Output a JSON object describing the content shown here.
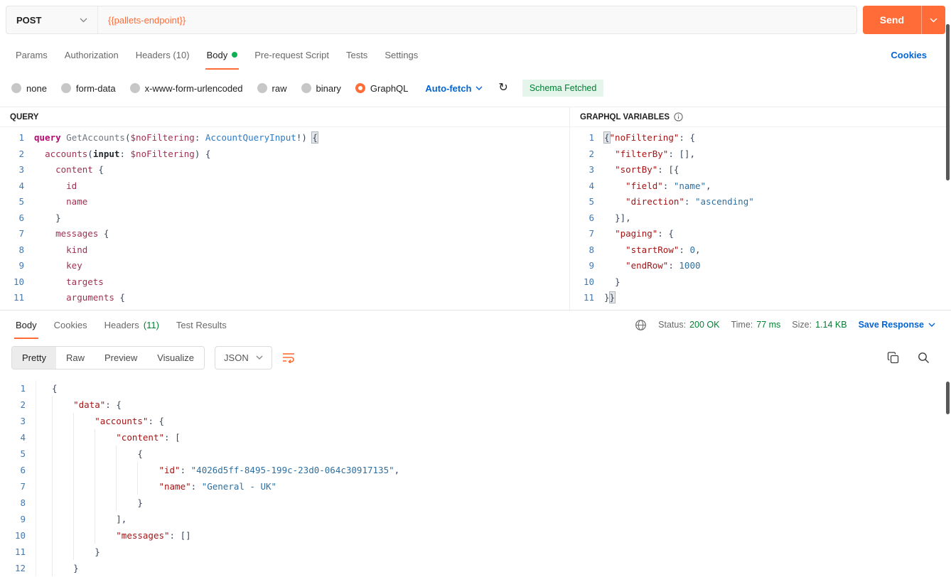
{
  "request": {
    "method": "POST",
    "url": "{{pallets-endpoint}}",
    "send_label": "Send"
  },
  "request_tabs": {
    "items": [
      {
        "label": "Params"
      },
      {
        "label": "Authorization"
      },
      {
        "label": "Headers (10)"
      },
      {
        "label": "Body"
      },
      {
        "label": "Pre-request Script"
      },
      {
        "label": "Tests"
      },
      {
        "label": "Settings"
      }
    ],
    "active": "Body",
    "cookies_link": "Cookies"
  },
  "body_type_bar": {
    "options": [
      {
        "label": "none",
        "selected": false
      },
      {
        "label": "form-data",
        "selected": false
      },
      {
        "label": "x-www-form-urlencoded",
        "selected": false
      },
      {
        "label": "raw",
        "selected": false
      },
      {
        "label": "binary",
        "selected": false
      },
      {
        "label": "GraphQL",
        "selected": true
      }
    ],
    "auto_fetch_label": "Auto-fetch",
    "schema_status": "Schema Fetched"
  },
  "query_panel": {
    "title": "QUERY",
    "code_lines": [
      [
        [
          "kw",
          "query"
        ],
        [
          "pl",
          " "
        ],
        [
          "def",
          "GetAccounts"
        ],
        [
          "pu",
          "("
        ],
        [
          "var",
          "$noFiltering"
        ],
        [
          "pu",
          ":"
        ],
        [
          "pl",
          " "
        ],
        [
          "type",
          "AccountQueryInput"
        ],
        [
          "pu",
          "!)"
        ],
        [
          "pl",
          " "
        ],
        [
          "hl",
          "{"
        ]
      ],
      [
        [
          "pl",
          "  "
        ],
        [
          "field",
          "accounts"
        ],
        [
          "pu",
          "("
        ],
        [
          "arg",
          "input"
        ],
        [
          "pu",
          ":"
        ],
        [
          "pl",
          " "
        ],
        [
          "var",
          "$noFiltering"
        ],
        [
          "pu",
          ")"
        ],
        [
          "pl",
          " "
        ],
        [
          "pu",
          "{"
        ]
      ],
      [
        [
          "pl",
          "    "
        ],
        [
          "field",
          "content"
        ],
        [
          "pl",
          " "
        ],
        [
          "pu",
          "{"
        ]
      ],
      [
        [
          "pl",
          "      "
        ],
        [
          "field",
          "id"
        ]
      ],
      [
        [
          "pl",
          "      "
        ],
        [
          "field",
          "name"
        ]
      ],
      [
        [
          "pl",
          "    "
        ],
        [
          "pu",
          "}"
        ]
      ],
      [
        [
          "pl",
          "    "
        ],
        [
          "field",
          "messages"
        ],
        [
          "pl",
          " "
        ],
        [
          "pu",
          "{"
        ]
      ],
      [
        [
          "pl",
          "      "
        ],
        [
          "field",
          "kind"
        ]
      ],
      [
        [
          "pl",
          "      "
        ],
        [
          "field",
          "key"
        ]
      ],
      [
        [
          "pl",
          "      "
        ],
        [
          "field",
          "targets"
        ]
      ],
      [
        [
          "pl",
          "      "
        ],
        [
          "field",
          "arguments"
        ],
        [
          "pl",
          " "
        ],
        [
          "pu",
          "{"
        ]
      ]
    ]
  },
  "variables_panel": {
    "title": "GRAPHQL VARIABLES",
    "code_lines": [
      [
        [
          "hl",
          "{"
        ],
        [
          "key",
          "\"noFiltering\""
        ],
        [
          "pu",
          ":"
        ],
        [
          "pl",
          " "
        ],
        [
          "pu",
          "{"
        ]
      ],
      [
        [
          "pl",
          "  "
        ],
        [
          "key",
          "\"filterBy\""
        ],
        [
          "pu",
          ":"
        ],
        [
          "pl",
          " "
        ],
        [
          "pu",
          "[],"
        ]
      ],
      [
        [
          "pl",
          "  "
        ],
        [
          "key",
          "\"sortBy\""
        ],
        [
          "pu",
          ":"
        ],
        [
          "pl",
          " "
        ],
        [
          "pu",
          "[{"
        ]
      ],
      [
        [
          "pl",
          "    "
        ],
        [
          "key",
          "\"field\""
        ],
        [
          "pu",
          ":"
        ],
        [
          "pl",
          " "
        ],
        [
          "str",
          "\"name\""
        ],
        [
          "pu",
          ","
        ]
      ],
      [
        [
          "pl",
          "    "
        ],
        [
          "key",
          "\"direction\""
        ],
        [
          "pu",
          ":"
        ],
        [
          "pl",
          " "
        ],
        [
          "str",
          "\"ascending\""
        ]
      ],
      [
        [
          "pl",
          "  "
        ],
        [
          "pu",
          "}],"
        ]
      ],
      [
        [
          "pl",
          "  "
        ],
        [
          "key",
          "\"paging\""
        ],
        [
          "pu",
          ":"
        ],
        [
          "pl",
          " "
        ],
        [
          "pu",
          "{"
        ]
      ],
      [
        [
          "pl",
          "    "
        ],
        [
          "key",
          "\"startRow\""
        ],
        [
          "pu",
          ":"
        ],
        [
          "pl",
          " "
        ],
        [
          "num",
          "0"
        ],
        [
          "pu",
          ","
        ]
      ],
      [
        [
          "pl",
          "    "
        ],
        [
          "key",
          "\"endRow\""
        ],
        [
          "pu",
          ":"
        ],
        [
          "pl",
          " "
        ],
        [
          "num",
          "1000"
        ]
      ],
      [
        [
          "pl",
          "  "
        ],
        [
          "pu",
          "}"
        ]
      ],
      [
        [
          "pu",
          "}"
        ],
        [
          "hl",
          "}"
        ]
      ]
    ]
  },
  "response": {
    "tabs": [
      {
        "label": "Body"
      },
      {
        "label": "Cookies"
      },
      {
        "label": "Headers",
        "count": "(11)"
      },
      {
        "label": "Test Results"
      }
    ],
    "active_tab": "Body",
    "meta": {
      "status_label": "Status:",
      "status_value": "200 OK",
      "time_label": "Time:",
      "time_value": "77 ms",
      "size_label": "Size:",
      "size_value": "1.14 KB",
      "save_label": "Save Response"
    },
    "view_modes": [
      "Pretty",
      "Raw",
      "Preview",
      "Visualize"
    ],
    "active_view": "Pretty",
    "format": "JSON",
    "code_lines": [
      [
        [
          "pu",
          "{"
        ]
      ],
      [
        [
          "ind",
          "    "
        ],
        [
          "key",
          "\"data\""
        ],
        [
          "pu",
          ":"
        ],
        [
          "pl",
          " "
        ],
        [
          "pu",
          "{"
        ]
      ],
      [
        [
          "ind",
          "    "
        ],
        [
          "ind",
          "    "
        ],
        [
          "key",
          "\"accounts\""
        ],
        [
          "pu",
          ":"
        ],
        [
          "pl",
          " "
        ],
        [
          "pu",
          "{"
        ]
      ],
      [
        [
          "ind",
          "    "
        ],
        [
          "ind",
          "    "
        ],
        [
          "ind",
          "    "
        ],
        [
          "key",
          "\"content\""
        ],
        [
          "pu",
          ":"
        ],
        [
          "pl",
          " "
        ],
        [
          "pu",
          "["
        ]
      ],
      [
        [
          "ind",
          "    "
        ],
        [
          "ind",
          "    "
        ],
        [
          "ind",
          "    "
        ],
        [
          "ind",
          "    "
        ],
        [
          "pu",
          "{"
        ]
      ],
      [
        [
          "ind",
          "    "
        ],
        [
          "ind",
          "    "
        ],
        [
          "ind",
          "    "
        ],
        [
          "ind",
          "    "
        ],
        [
          "ind",
          "    "
        ],
        [
          "key",
          "\"id\""
        ],
        [
          "pu",
          ":"
        ],
        [
          "pl",
          " "
        ],
        [
          "str",
          "\"4026d5ff-8495-199c-23d0-064c30917135\""
        ],
        [
          "pu",
          ","
        ]
      ],
      [
        [
          "ind",
          "    "
        ],
        [
          "ind",
          "    "
        ],
        [
          "ind",
          "    "
        ],
        [
          "ind",
          "    "
        ],
        [
          "ind",
          "    "
        ],
        [
          "key",
          "\"name\""
        ],
        [
          "pu",
          ":"
        ],
        [
          "pl",
          " "
        ],
        [
          "str",
          "\"General - UK\""
        ]
      ],
      [
        [
          "ind",
          "    "
        ],
        [
          "ind",
          "    "
        ],
        [
          "ind",
          "    "
        ],
        [
          "ind",
          "    "
        ],
        [
          "pu",
          "}"
        ]
      ],
      [
        [
          "ind",
          "    "
        ],
        [
          "ind",
          "    "
        ],
        [
          "ind",
          "    "
        ],
        [
          "pu",
          "],"
        ]
      ],
      [
        [
          "ind",
          "    "
        ],
        [
          "ind",
          "    "
        ],
        [
          "ind",
          "    "
        ],
        [
          "key",
          "\"messages\""
        ],
        [
          "pu",
          ":"
        ],
        [
          "pl",
          " "
        ],
        [
          "pu",
          "[]"
        ]
      ],
      [
        [
          "ind",
          "    "
        ],
        [
          "ind",
          "    "
        ],
        [
          "pu",
          "}"
        ]
      ],
      [
        [
          "ind",
          "    "
        ],
        [
          "pu",
          "}"
        ]
      ]
    ]
  },
  "colors": {
    "accent_orange": "#ff6c37",
    "success_green": "#007f31",
    "link_blue": "#0265d2",
    "body_dot_green": "#0faf54"
  }
}
